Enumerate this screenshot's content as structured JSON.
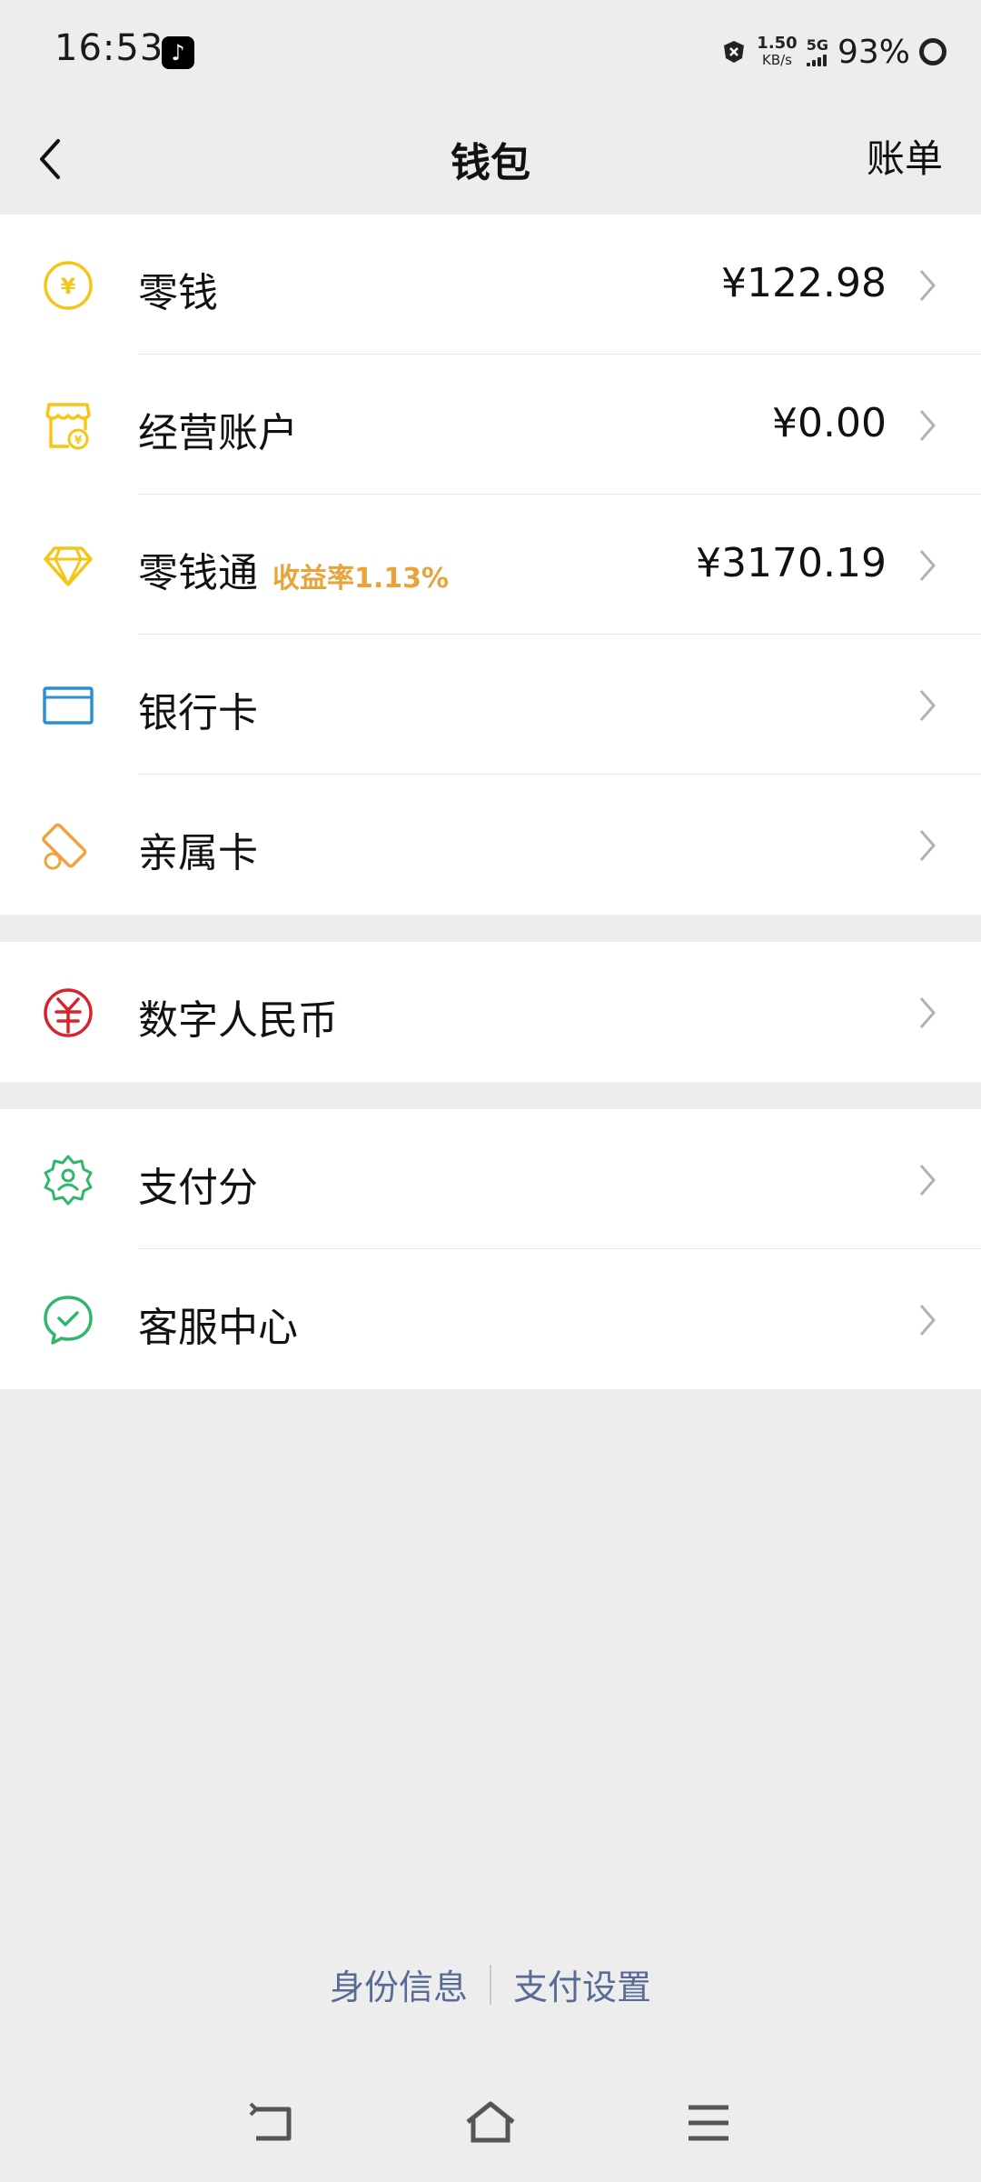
{
  "status_bar": {
    "time": "16:53",
    "net_speed": "1.50",
    "net_unit": "KB/s",
    "signal": "5G",
    "battery": "93%"
  },
  "nav": {
    "title": "钱包",
    "bill": "账单"
  },
  "group1": [
    {
      "label": "零钱",
      "value": "¥122.98",
      "icon": "yuan-coin-icon",
      "color": "#f5c518"
    },
    {
      "label": "经营账户",
      "value": "¥0.00",
      "icon": "shop-icon",
      "color": "#f5c518"
    },
    {
      "label": "零钱通",
      "rate": "收益率1.13%",
      "value": "¥3170.19",
      "icon": "diamond-icon",
      "color": "#f5c518"
    },
    {
      "label": "银行卡",
      "icon": "card-icon",
      "color": "#2b8fd6"
    },
    {
      "label": "亲属卡",
      "icon": "family-card-icon",
      "color": "#f0a33c"
    }
  ],
  "group2": [
    {
      "label": "数字人民币",
      "icon": "digital-rmb-icon",
      "color": "#d8232a"
    }
  ],
  "group3": [
    {
      "label": "支付分",
      "icon": "pay-score-icon",
      "color": "#2fb86a"
    },
    {
      "label": "客服中心",
      "icon": "customer-service-icon",
      "color": "#2fb86a"
    }
  ],
  "footer": {
    "identity": "身份信息",
    "pay_settings": "支付设置"
  }
}
